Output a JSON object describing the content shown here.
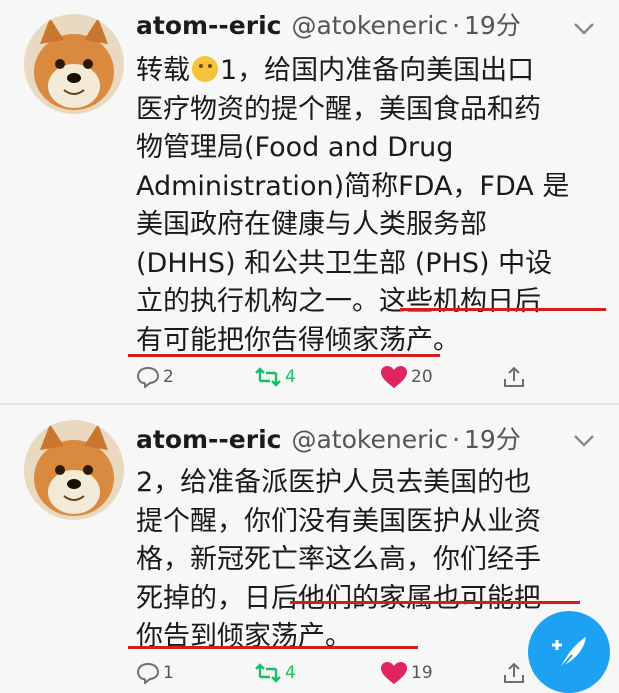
{
  "tweets": [
    {
      "author_name": "atom--eric",
      "handle": "@atokeneric",
      "separator": "·",
      "time": "19分",
      "lines": [
        {
          "pre": "转载",
          "emoji": true,
          "post": "1，给国内准备向美国出口"
        },
        {
          "text": "医疗物资的提个醒，美国食品和药"
        },
        {
          "text": "物管理局(Food and Drug"
        },
        {
          "text": "Administration)简称FDA，FDA 是"
        },
        {
          "text": "美国政府在健康与人类服务部"
        },
        {
          "text": "(DHHS) 和公共卫生部 (PHS) 中设"
        },
        {
          "text": "立的执行机构之一。这些机构日后"
        },
        {
          "text": "有可能把你告得倾家荡产。"
        }
      ],
      "replies": "2",
      "retweets": "4",
      "likes": "20"
    },
    {
      "author_name": "atom--eric",
      "handle": "@atokeneric",
      "separator": "·",
      "time": "19分",
      "lines": [
        {
          "text": "2，给准备派医护人员去美国的也"
        },
        {
          "text": "提个醒，你们没有美国医护从业资"
        },
        {
          "text": "格，新冠死亡率这么高，你们经手"
        },
        {
          "text": "死掉的，日后他们的家属也可能把"
        },
        {
          "text": "你告到倾家荡产。"
        }
      ],
      "replies": "1",
      "retweets": "4",
      "likes": "19"
    }
  ],
  "colors": {
    "background": "#f7f7f7",
    "underline": "#d31e1e",
    "like_heart": "#e0245e",
    "retweet": "#17bf63",
    "fab": "#1da1f2"
  },
  "icons": [
    "avatar-shiba",
    "chevron-down-icon",
    "reply-icon",
    "retweet-icon",
    "heart-icon",
    "share-icon",
    "compose-feather-icon"
  ]
}
